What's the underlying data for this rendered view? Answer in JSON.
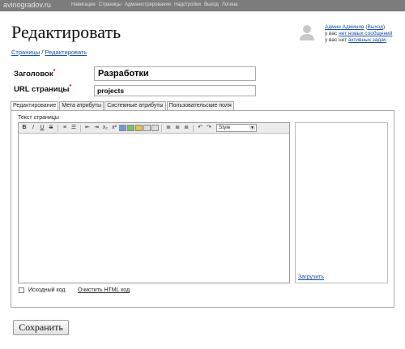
{
  "topbar": {
    "site_name": "avinogradov.ru",
    "nav": [
      "Навигация",
      "Страницы",
      "Администрирование",
      "Надстройки",
      "Выход",
      "Логина"
    ]
  },
  "page_title": "Редактировать",
  "user": {
    "name": "Админ Админов",
    "logout": "Выход",
    "line2_prefix": "у вас",
    "messages": "нет новых сообщений",
    "line3_prefix": "у вас нет",
    "tasks": "активных задач"
  },
  "breadcrumb": {
    "item1": "Страницы",
    "sep": "/",
    "item2": "Редактировать"
  },
  "form": {
    "title_label": "Заголовок",
    "title_value": "Разработки",
    "url_label": "URL страницы",
    "url_value": "projects",
    "required_mark": "*"
  },
  "tabs": [
    "Редактирование",
    "Мета атрибуты",
    "Системные атрибуты",
    "Пользовательские поля"
  ],
  "editor": {
    "label": "Текст страницы",
    "style_select": "Style"
  },
  "sidepanel": {
    "upload_link": "Загрузить"
  },
  "bottom": {
    "source_label": "Исходный код",
    "clean_link": "Очистить HTML код"
  },
  "save_button": "Сохранить"
}
